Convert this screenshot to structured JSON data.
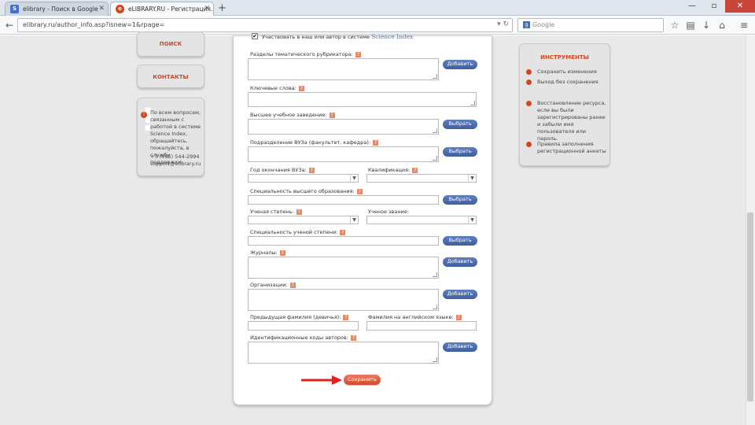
{
  "browser": {
    "tabs": [
      {
        "label": "elibrary - Поиск в Google",
        "icon": "google-icon",
        "active": false
      },
      {
        "label": "eLIBRARY.RU - Регистрация...",
        "icon": "elibrary-icon",
        "active": true
      }
    ],
    "url": "elibrary.ru/author_info.asp?isnew=1&rpage=",
    "search_placeholder": "Google",
    "close_glyph": "✕"
  },
  "left_menu": {
    "search_label": "ПОИСК",
    "contacts_label": "КОНТАКТЫ"
  },
  "help": {
    "text": "По всем вопросам, связанным с работой в системе Science Index, обращайтесь, пожалуйста, в службу поддержки:",
    "phone": "+7 (495) 544-2994",
    "email": "support@elibrary.ru"
  },
  "form": {
    "checkbox_label": "Участвовать в наш или автор в системе",
    "brand": "Science Index",
    "fields": {
      "rubrics": "Разделы тематического рубрикатора:",
      "keywords": "Ключевые слова:",
      "university": "Высшее учебное заведение:",
      "division": "Подразделение ВУЗа (факультет, кафедра):",
      "grad_year": "Год окончания ВУЗа:",
      "qualification": "Квалификация:",
      "specialty": "Специальность высшего образования:",
      "degree": "Ученая степень:",
      "title": "Ученое звание:",
      "degree_specialty": "Специальность ученой степени:",
      "journals": "Журналы:",
      "organizations": "Организации:",
      "prev_surname": "Предыдущая фамилия (девичья):",
      "english_name": "Фамилия на английском языке:",
      "author_ids": "Идентификационные коды авторов:"
    },
    "buttons": {
      "add": "Добавить",
      "choose": "Выбрать",
      "save": "Сохранить"
    }
  },
  "tools": {
    "title": "ИНСТРУМЕНТЫ",
    "save_changes": "Сохранить изменения",
    "exit_no_save": "Выход без сохранения",
    "restore_text": "Восстановление ресурса, если вы были зарегистрированы ранее и забыли имя пользователя или пароль.",
    "rules_text": "Правила заполнения регистрационной анкеты"
  },
  "colors": {
    "accent": "#d3451f",
    "button_blue": "#3e5e9e",
    "arrow_red": "#e02020"
  }
}
